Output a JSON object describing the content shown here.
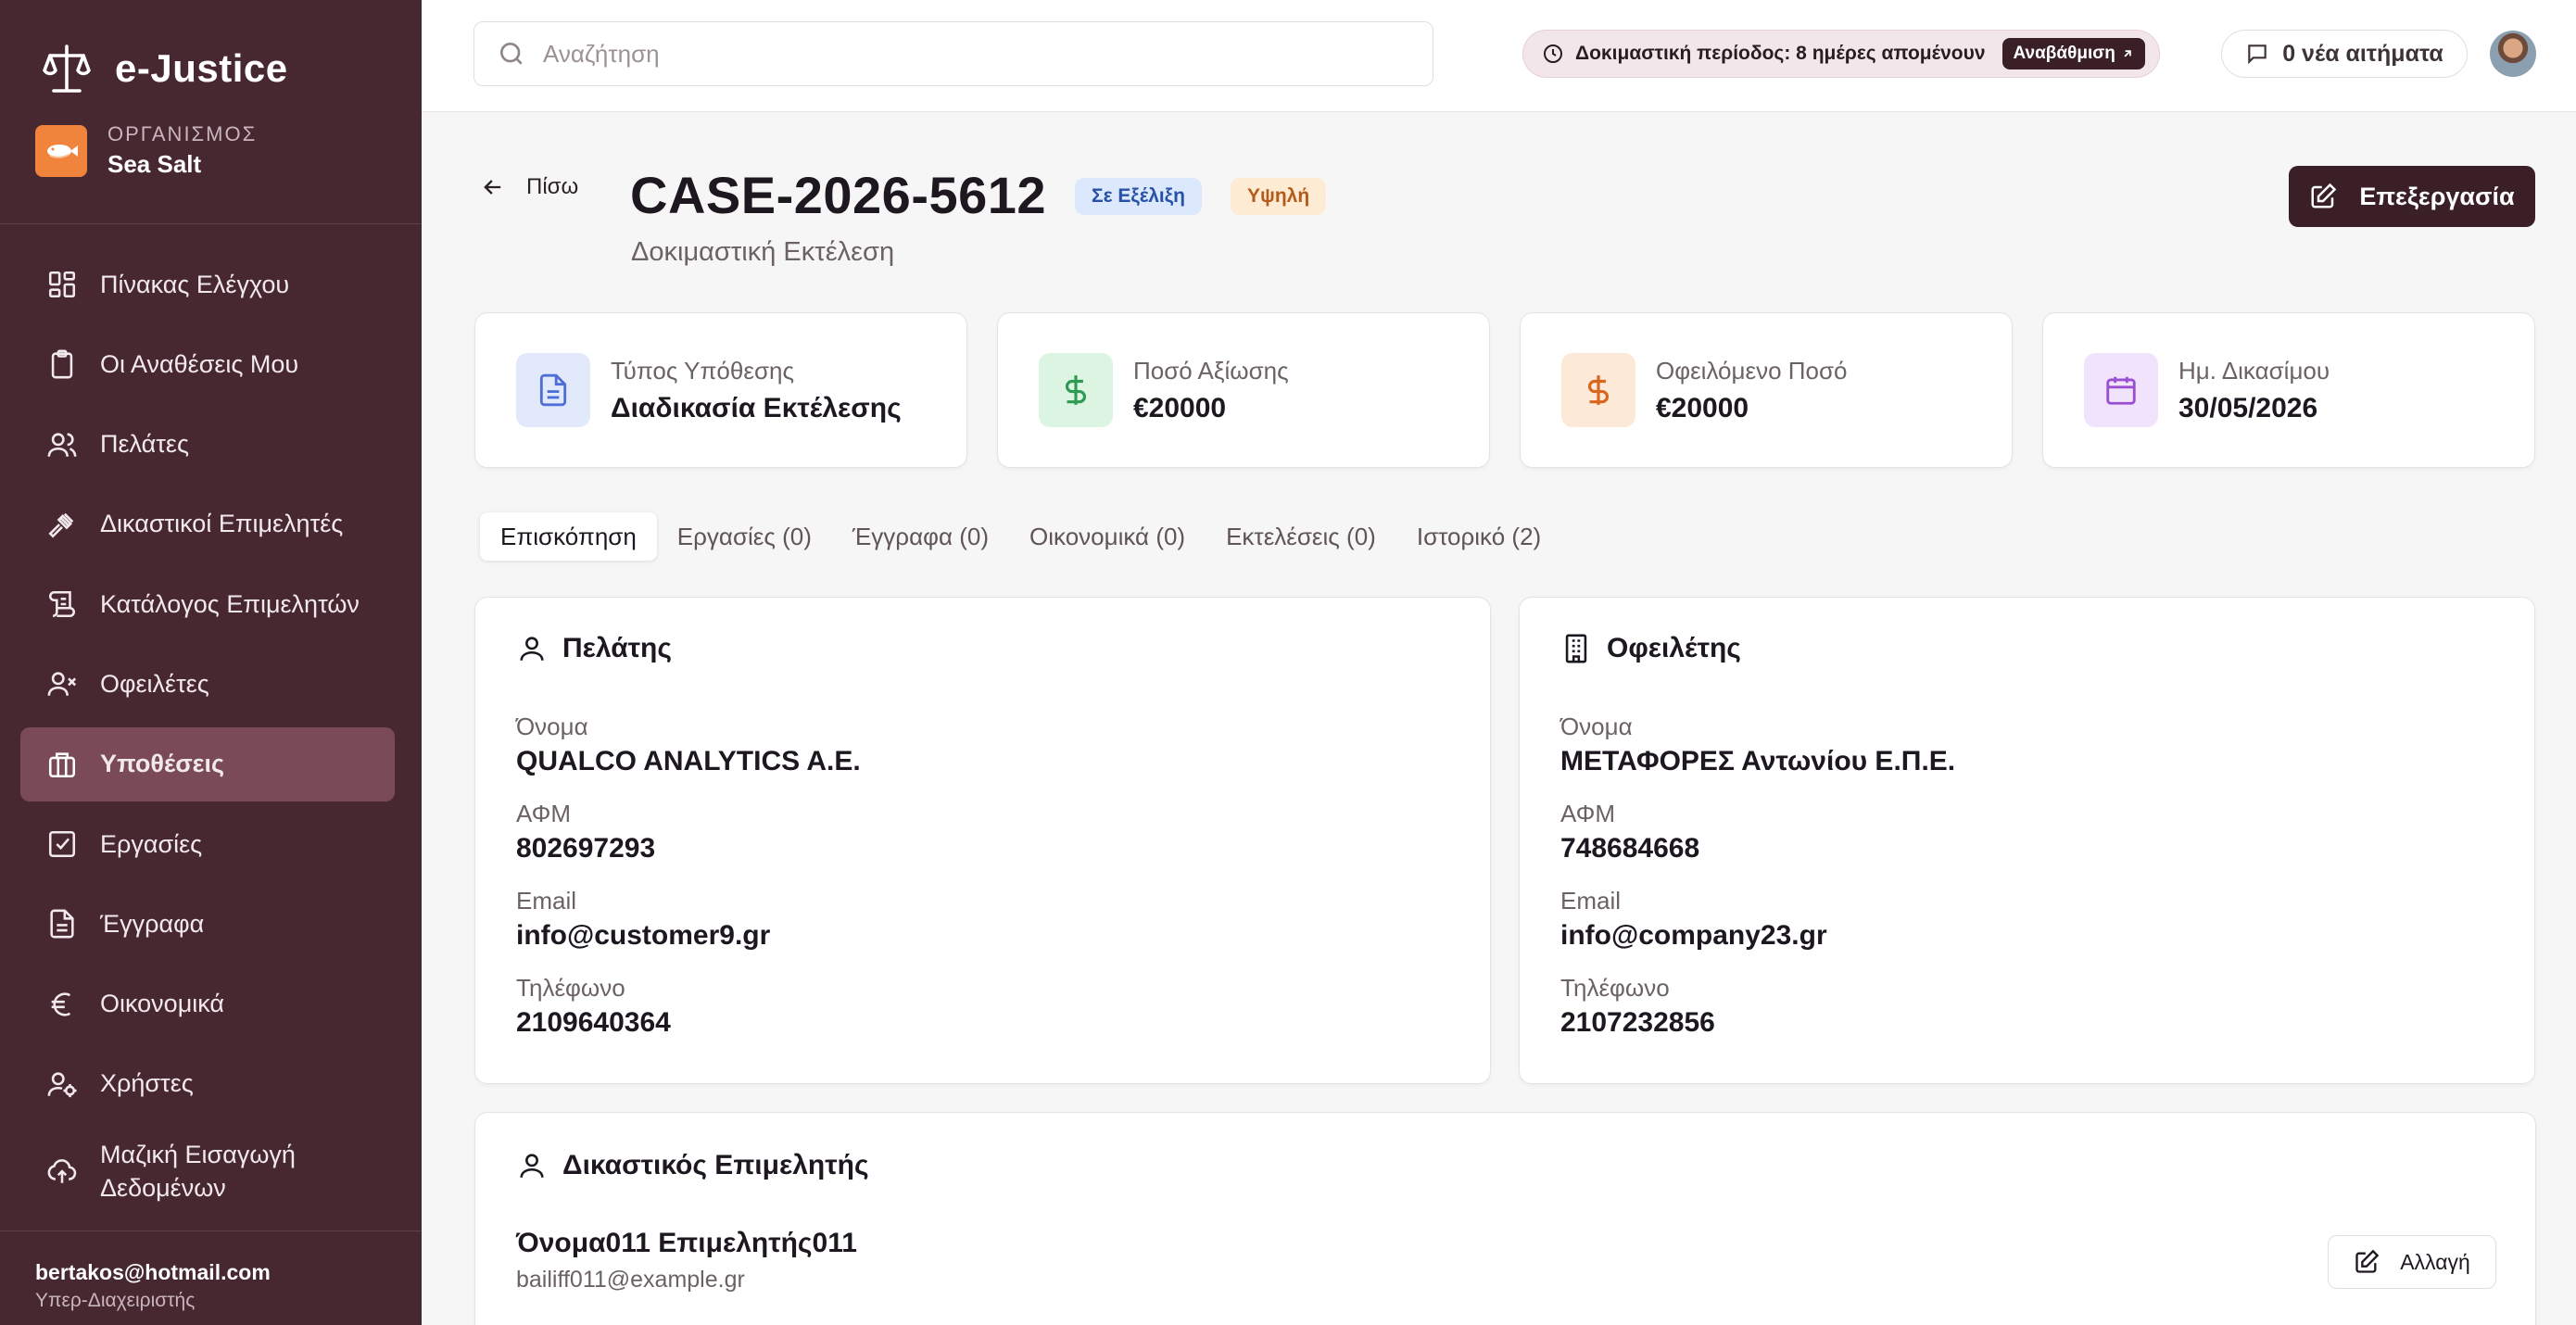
{
  "app": {
    "name": "e-Justice",
    "org_label": "ΟΡΓΑΝΙΣΜΟΣ",
    "org_name": "Sea Salt"
  },
  "sidebar": {
    "items": [
      {
        "label": "Πίνακας Ελέγχου",
        "icon": "dashboard-icon"
      },
      {
        "label": "Οι Αναθέσεις Μου",
        "icon": "clipboard-icon"
      },
      {
        "label": "Πελάτες",
        "icon": "users-icon"
      },
      {
        "label": "Δικαστικοί Επιμελητές",
        "icon": "gavel-icon"
      },
      {
        "label": "Κατάλογος Επιμελητών",
        "icon": "scroll-icon"
      },
      {
        "label": "Οφειλέτες",
        "icon": "user-x-icon"
      },
      {
        "label": "Υποθέσεις",
        "icon": "briefcase-icon",
        "active": true
      },
      {
        "label": "Εργασίες",
        "icon": "checkbox-icon"
      },
      {
        "label": "Έγγραφα",
        "icon": "document-icon"
      },
      {
        "label": "Οικονομικά",
        "icon": "euro-icon"
      },
      {
        "label": "Χρήστες",
        "icon": "user-gear-icon"
      },
      {
        "label_line1": "Μαζική Εισαγωγή",
        "label_line2": "Δεδομένων",
        "icon": "cloud-upload-icon"
      }
    ],
    "user_email": "bertakos@hotmail.com",
    "user_role": "Υπερ-Διαχειριστής"
  },
  "topbar": {
    "search_placeholder": "Αναζήτηση",
    "trial_text": "Δοκιμαστική περίοδος: 8 ημέρες απομένουν",
    "upgrade_label": "Αναβάθμιση",
    "requests_label": "0 νέα αιτήματα"
  },
  "case": {
    "back_label": "Πίσω",
    "id": "CASE-2026-5612",
    "status": "Σε Εξέλιξη",
    "priority": "Υψηλή",
    "subtitle": "Δοκιμαστική Εκτέλεση",
    "edit_label": "Επεξεργασία"
  },
  "stats": [
    {
      "label": "Τύπος Υπόθεσης",
      "value": "Διαδικασία Εκτέλεσης",
      "icon": "document-icon",
      "color": "#4f6fd6",
      "bg": "#e2e9fb"
    },
    {
      "label": "Ποσό Αξίωσης",
      "value": "€20000",
      "icon": "dollar-icon",
      "color": "#2f9a52",
      "bg": "#dcf5e3"
    },
    {
      "label": "Οφειλόμενο Ποσό",
      "value": "€20000",
      "icon": "dollar-icon",
      "color": "#d9661f",
      "bg": "#fde9d8"
    },
    {
      "label": "Ημ. Δικασίμου",
      "value": "30/05/2026",
      "icon": "calendar-icon",
      "color": "#9a4fd0",
      "bg": "#f1e3fb"
    }
  ],
  "tabs": [
    "Επισκόπηση",
    "Εργασίες (0)",
    "Έγγραφα (0)",
    "Οικονομικά (0)",
    "Εκτελέσεις (0)",
    "Ιστορικό (2)"
  ],
  "client": {
    "title": "Πελάτης",
    "name_label": "Όνομα",
    "name": "QUALCO ANALYTICS A.E.",
    "vat_label": "ΑΦΜ",
    "vat": "802697293",
    "email_label": "Email",
    "email": "info@customer9.gr",
    "phone_label": "Τηλέφωνο",
    "phone": "2109640364"
  },
  "debtor": {
    "title": "Οφειλέτης",
    "name_label": "Όνομα",
    "name": "ΜΕΤΑΦΟΡΕΣ Αντωνίου Ε.Π.Ε.",
    "vat_label": "ΑΦΜ",
    "vat": "748684668",
    "email_label": "Email",
    "email": "info@company23.gr",
    "phone_label": "Τηλέφωνο",
    "phone": "2107232856"
  },
  "bailiff": {
    "title": "Δικαστικός Επιμελητής",
    "name": "Όνομα011 Επιμελητής011",
    "email": "bailiff011@example.gr",
    "change_label": "Αλλαγή"
  }
}
